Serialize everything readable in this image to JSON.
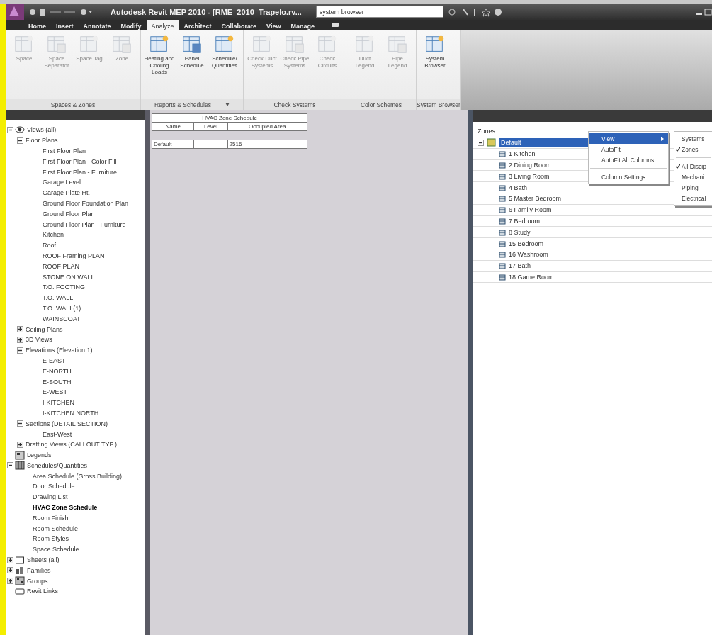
{
  "title_bar": {
    "title": "Autodesk Revit MEP 2010 - [RME_2010_Trapelo.rv...",
    "search": {
      "value": "system browser"
    }
  },
  "tabs": [
    {
      "label": "Home",
      "selected": false
    },
    {
      "label": "Insert",
      "selected": false
    },
    {
      "label": "Annotate",
      "selected": false
    },
    {
      "label": "Modify",
      "selected": false
    },
    {
      "label": "Analyze",
      "selected": true
    },
    {
      "label": "Architect",
      "selected": false
    },
    {
      "label": "Collaborate",
      "selected": false
    },
    {
      "label": "View",
      "selected": false
    },
    {
      "label": "Manage",
      "selected": false
    }
  ],
  "ribbon": [
    {
      "title": "Spaces & Zones",
      "launcher": false,
      "buttons": [
        {
          "label": "Space",
          "disabled": true
        },
        {
          "label": "Space Separator",
          "disabled": true
        },
        {
          "label": "Space Tag",
          "disabled": true
        },
        {
          "label": "Zone",
          "disabled": true
        }
      ]
    },
    {
      "title": "Reports & Schedules",
      "launcher": true,
      "buttons": [
        {
          "label": "Heating and Cooling Loads",
          "disabled": false
        },
        {
          "label": "Panel Schedule",
          "disabled": false
        },
        {
          "label": "Schedule/ Quantities",
          "disabled": false
        }
      ]
    },
    {
      "title": "Check Systems",
      "launcher": false,
      "buttons": [
        {
          "label": "Check Duct Systems",
          "disabled": true
        },
        {
          "label": "Check Pipe Systems",
          "disabled": true
        },
        {
          "label": "Check Circuits",
          "disabled": true
        }
      ]
    },
    {
      "title": "Color Schemes",
      "launcher": false,
      "buttons": [
        {
          "label": "Duct Legend",
          "disabled": true
        },
        {
          "label": "Pipe Legend",
          "disabled": true
        }
      ]
    },
    {
      "title": "System Browser",
      "launcher": false,
      "buttons": [
        {
          "label": "System Browser",
          "disabled": false
        }
      ]
    }
  ],
  "project_browser": [
    {
      "label": "Views (all)",
      "kind": "views",
      "expanded": true,
      "children": [
        {
          "label": "Floor Plans",
          "expanded": true,
          "children": [
            {
              "label": "First Floor Plan"
            },
            {
              "label": "First Floor Plan - Color Fill"
            },
            {
              "label": "First Floor Plan - Furniture"
            },
            {
              "label": "Garage Level"
            },
            {
              "label": "Garage Plate Ht."
            },
            {
              "label": "Ground Floor Foundation Plan"
            },
            {
              "label": "Ground Floor Plan"
            },
            {
              "label": "Ground Floor Plan - Furniture"
            },
            {
              "label": "Kitchen"
            },
            {
              "label": "Roof"
            },
            {
              "label": "ROOF Framing PLAN"
            },
            {
              "label": "ROOF PLAN"
            },
            {
              "label": "STONE ON WALL"
            },
            {
              "label": "T.O. FOOTING"
            },
            {
              "label": "T.O. WALL"
            },
            {
              "label": "T.O. WALL(1)"
            },
            {
              "label": "WAINSCOAT"
            }
          ]
        },
        {
          "label": "Ceiling Plans",
          "expanded": false
        },
        {
          "label": "3D Views",
          "expanded": false
        },
        {
          "label": "Elevations (Elevation 1)",
          "expanded": true,
          "children": [
            {
              "label": "E-EAST"
            },
            {
              "label": "E-NORTH"
            },
            {
              "label": "E-SOUTH"
            },
            {
              "label": "E-WEST"
            },
            {
              "label": "I-KITCHEN"
            },
            {
              "label": "I-KITCHEN NORTH"
            }
          ]
        },
        {
          "label": "Sections (DETAIL SECTION)",
          "expanded": true,
          "children": [
            {
              "label": "East-West"
            }
          ]
        },
        {
          "label": "Drafting Views (CALLOUT TYP.)",
          "expanded": false
        }
      ]
    },
    {
      "label": "Legends",
      "kind": "legends"
    },
    {
      "label": "Schedules/Quantities",
      "kind": "schedules",
      "expanded": true,
      "children": [
        {
          "label": "Area Schedule (Gross Building)",
          "selected": false
        },
        {
          "label": "Door Schedule",
          "selected": false
        },
        {
          "label": "Drawing List",
          "selected": false
        },
        {
          "label": "HVAC Zone Schedule",
          "selected": true
        },
        {
          "label": "Room Finish",
          "selected": false
        },
        {
          "label": "Room Schedule",
          "selected": false
        },
        {
          "label": "Room Styles",
          "selected": false
        },
        {
          "label": "Space Schedule",
          "selected": false
        }
      ]
    },
    {
      "label": "Sheets (all)",
      "kind": "sheets",
      "expanded": false
    },
    {
      "label": "Families",
      "kind": "families",
      "expanded": false
    },
    {
      "label": "Groups",
      "kind": "groups",
      "expanded": false
    },
    {
      "label": "Revit Links",
      "kind": "links"
    }
  ],
  "schedule": {
    "title": "HVAC Zone Schedule",
    "columns": [
      "Name",
      "Level",
      "Occupied Area"
    ],
    "rows": [
      [
        "Default",
        null,
        "2516"
      ]
    ]
  },
  "system_browser": {
    "header": "Zones",
    "root": {
      "label": "Default",
      "selected": true
    },
    "zones": [
      "1 Kitchen",
      "2 Dining Room",
      "3 Living Room",
      "4 Bath",
      "5 Master Bedroom",
      "6 Family Room",
      "7 Bedroom",
      "8 Study",
      "15 Bedroom",
      "16 Washroom",
      "17 Bath",
      "18 Game Room"
    ],
    "context_menu": [
      {
        "label": "View",
        "selected": true,
        "submenu": true
      },
      {
        "label": "AutoFit",
        "selected": false,
        "submenu": false
      },
      {
        "label": "AutoFit All Columns",
        "selected": false,
        "submenu": false,
        "separator_after": true
      },
      {
        "label": "Column Settings...",
        "selected": false,
        "submenu": false
      }
    ],
    "submenu": [
      {
        "label": "Systems",
        "checked": false
      },
      {
        "label": "Zones",
        "checked": true,
        "separator_after": true
      },
      {
        "label": "All Discip",
        "checked": true
      },
      {
        "label": "Mechani",
        "checked": false
      },
      {
        "label": "Piping",
        "checked": false
      },
      {
        "label": "Electrical",
        "checked": false
      }
    ]
  }
}
